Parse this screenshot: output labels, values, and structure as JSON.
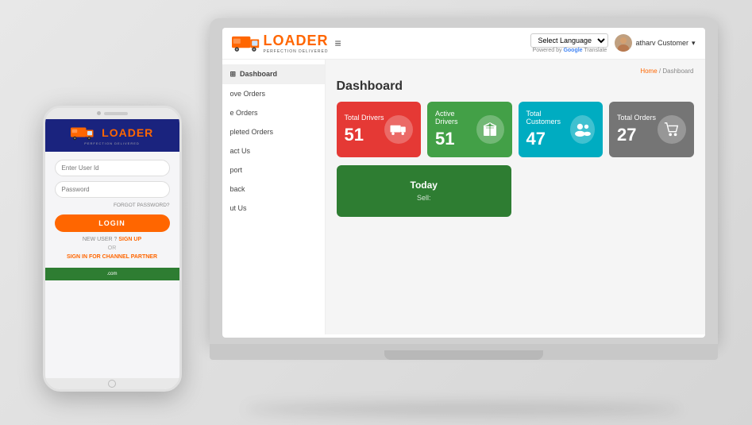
{
  "app": {
    "logo_text": "LOADER",
    "logo_subtitle": "PERFECTION DELIVERED",
    "language_select": "Select Language",
    "powered_by": "Powered by",
    "powered_google": "Google",
    "translate": "Translate",
    "user_name": "atharv Customer",
    "user_chevron": "▾"
  },
  "header": {
    "hamburger": "≡"
  },
  "breadcrumb": {
    "home": "Home",
    "separator": " / ",
    "current": "Dashboard"
  },
  "page": {
    "title": "Dashboard"
  },
  "sidebar": {
    "items": [
      {
        "label": "Dashboard",
        "icon": "⊞"
      },
      {
        "label": "ove Orders",
        "icon": ""
      },
      {
        "label": "e Orders",
        "icon": ""
      },
      {
        "label": "pleted Orders",
        "icon": ""
      },
      {
        "label": "act Us",
        "icon": ""
      },
      {
        "label": "port",
        "icon": ""
      },
      {
        "label": "back",
        "icon": ""
      },
      {
        "label": "ut Us",
        "icon": ""
      }
    ]
  },
  "stats": [
    {
      "label": "Total Drivers",
      "value": "51",
      "color": "red",
      "icon": "🚚"
    },
    {
      "label": "Active Drivers",
      "value": "51",
      "color": "green",
      "icon": "📦"
    },
    {
      "label": "Total Customers",
      "value": "47",
      "color": "teal",
      "icon": "👥"
    },
    {
      "label": "Total Orders",
      "value": "27",
      "color": "gray",
      "icon": "🛒"
    }
  ],
  "today_card": {
    "title": "Today",
    "subtitle": "Sell:"
  },
  "mobile": {
    "logo_text": "LOADER",
    "logo_subtitle": "PERFECTION DELIVERED",
    "user_id_placeholder": "Enter User Id",
    "password_placeholder": "Password",
    "forgot_password": "FORGOT PASSWORD?",
    "login_label": "LOGIN",
    "new_user_text": "NEW USER ?",
    "signup_label": "SIGN UP",
    "or_label": "OR",
    "channel_partner_label": "SIGN IN FOR CHANNEL PARTNER",
    "footer_text": ".com"
  }
}
